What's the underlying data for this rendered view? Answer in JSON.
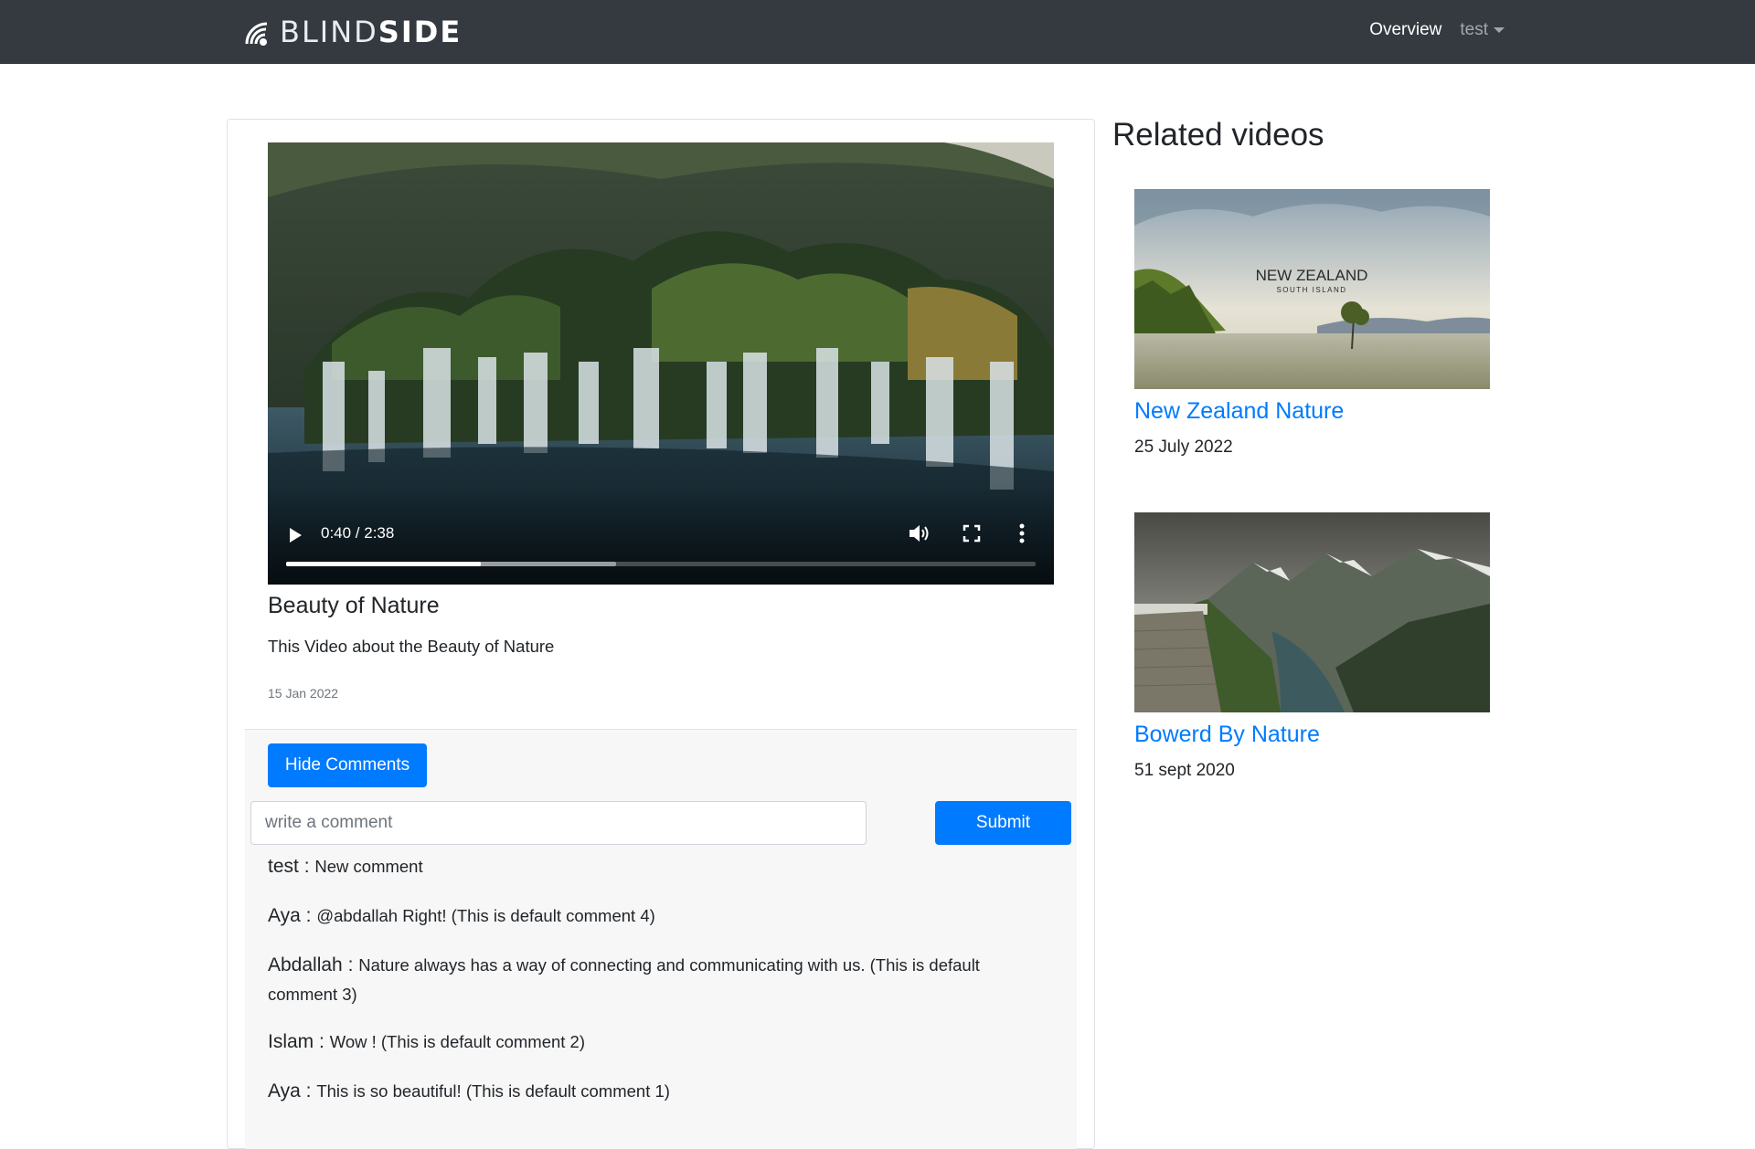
{
  "navbar": {
    "brand_light": "BLIND",
    "brand_bold": "SIDE",
    "overview_label": "Overview",
    "user_label": "test"
  },
  "video": {
    "current_time": "0:40",
    "duration": "2:38",
    "time_display": "0:40 / 2:38",
    "progress": 0.26,
    "title": "Beauty of Nature",
    "description": "This Video about the Beauty of Nature",
    "date": "15 Jan 2022"
  },
  "comments": {
    "hide_button_label": "Hide Comments",
    "input_placeholder": "write a comment",
    "input_value": "",
    "submit_label": "Submit",
    "items": [
      {
        "author": "test",
        "text": "New comment"
      },
      {
        "author": "Aya",
        "text": "@abdallah Right! (This is default comment 4)"
      },
      {
        "author": "Abdallah",
        "text": "Nature always has a way of connecting and communicating with us. (This is default comment 3)"
      },
      {
        "author": "Islam",
        "text": "Wow ! (This is default comment 2)"
      },
      {
        "author": "Aya",
        "text": "This is so beautiful! (This is default comment 1)"
      }
    ]
  },
  "related": {
    "heading": "Related videos",
    "items": [
      {
        "title": "New Zealand Nature",
        "date": "25 July 2022",
        "thumb_title": "NEW ZEALAND",
        "thumb_subtitle": "SOUTH ISLAND"
      },
      {
        "title": "Bowerd By Nature",
        "date": "51 sept 2020"
      }
    ]
  },
  "colors": {
    "navbar_bg": "#343a40",
    "primary": "#007bff",
    "comments_bg": "#f7f7f7"
  }
}
